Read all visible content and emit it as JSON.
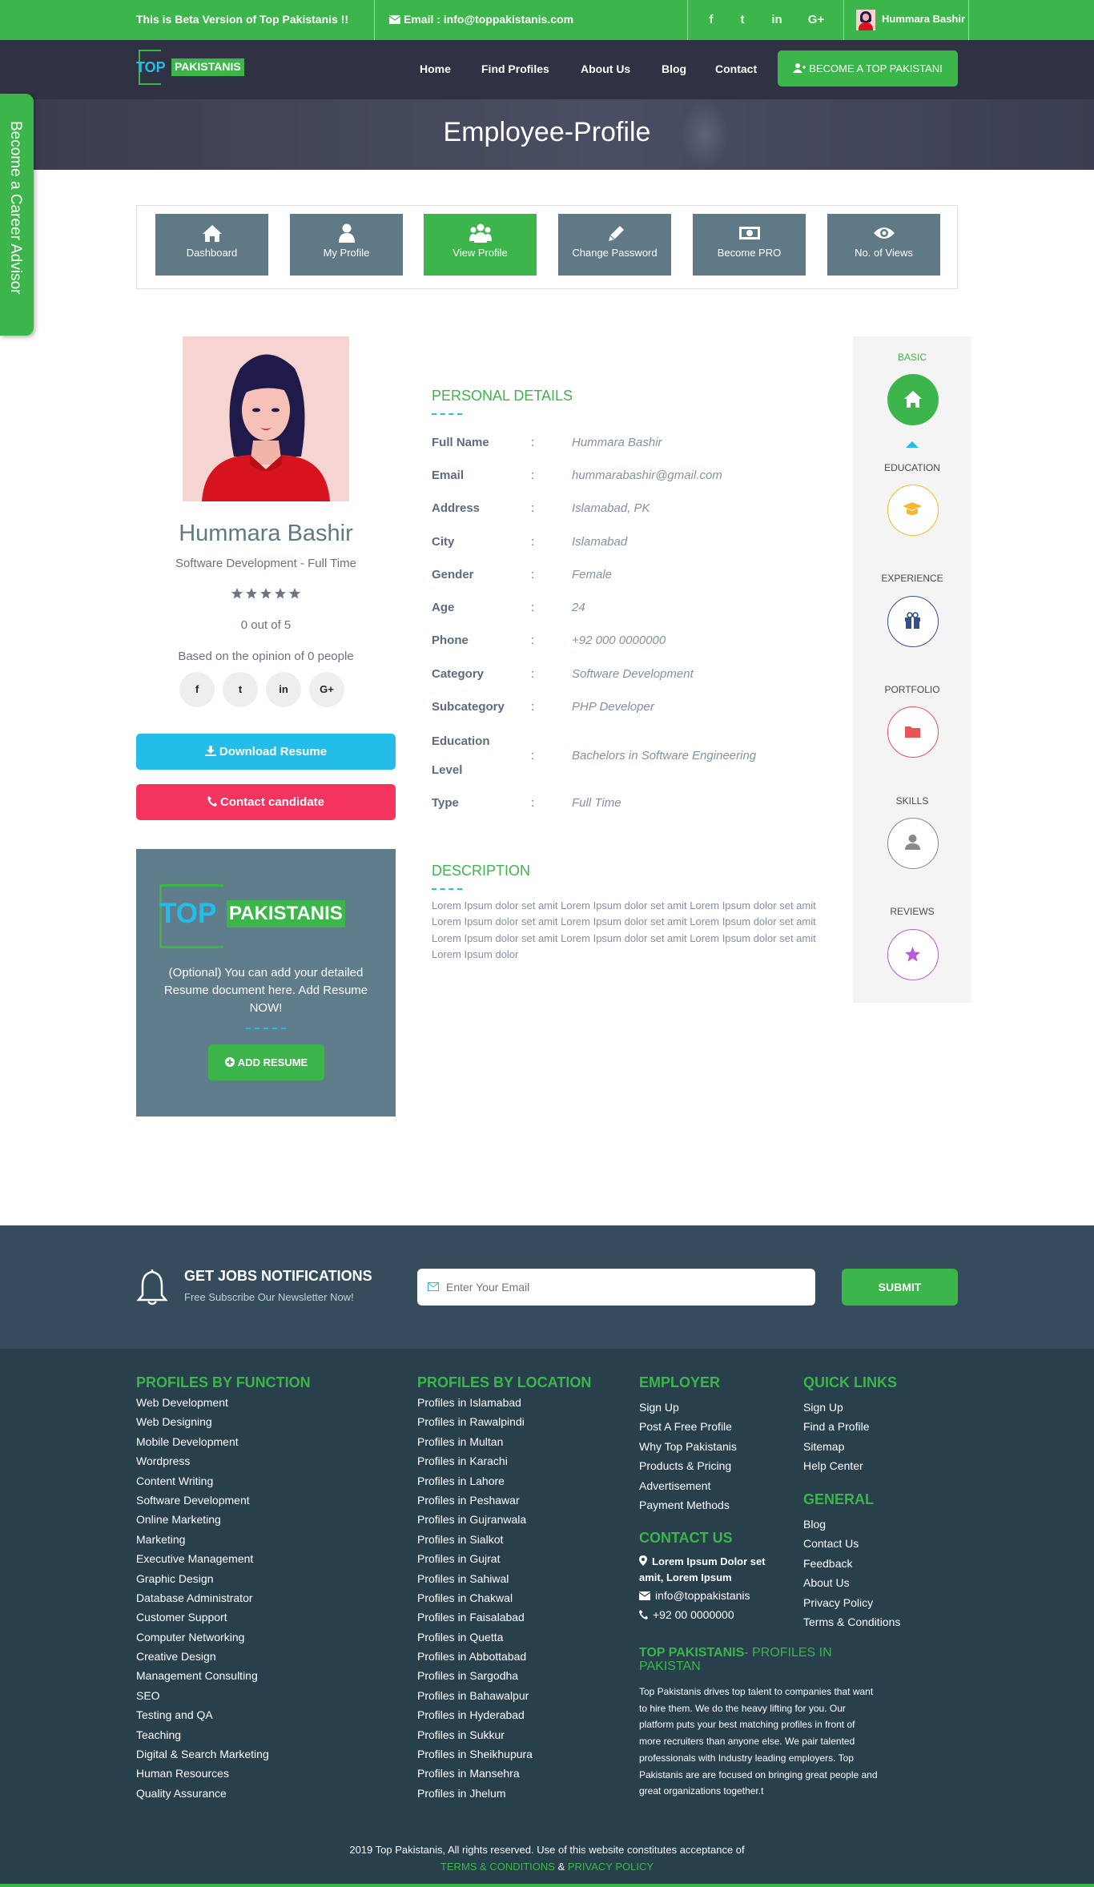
{
  "topbar": {
    "beta_text": "This is Beta Version of Top Pakistanis !!",
    "email_text": "Email : info@toppakistanis.com",
    "social": [
      "f",
      "t",
      "in",
      "G+"
    ],
    "user_name": "Hummara Bashir"
  },
  "logo": {
    "part1": "TOP",
    "part2": "PAKISTANIS"
  },
  "nav": {
    "items": [
      "Home",
      "Find Profiles",
      "About Us",
      "Blog",
      "Contact"
    ],
    "cta": "BECOME A TOP PAKISTANI"
  },
  "page_title": "Employee-Profile",
  "career_tab": "Become a Career Advisor",
  "tabs": [
    {
      "label": "Dashboard",
      "icon": "home-icon"
    },
    {
      "label": "My Profile",
      "icon": "user-icon"
    },
    {
      "label": "View Profile",
      "icon": "users-icon",
      "active": true
    },
    {
      "label": "Change Password",
      "icon": "pencil-icon"
    },
    {
      "label": "Become PRO",
      "icon": "money-icon"
    },
    {
      "label": "No. of Views",
      "icon": "eye-icon"
    }
  ],
  "profile": {
    "name": "Hummara Bashir",
    "subtitle": "Software Development - Full Time",
    "rating_value": 0,
    "rating_max": 5,
    "rating_text": "0 out of 5",
    "opinion_text": "Based on the opinion of 0 people",
    "social": [
      "f",
      "t",
      "in",
      "G+"
    ],
    "download_label": "Download Resume",
    "contact_label": "Contact candidate"
  },
  "resume_card": {
    "text": "(Optional) You can add your detailed Resume document here. Add Resume NOW!",
    "button": "ADD RESUME"
  },
  "personal_details": {
    "title": "PERSONAL DETAILS",
    "separator": ":",
    "rows": [
      {
        "label": "Full Name",
        "value": "Hummara Bashir"
      },
      {
        "label": "Email",
        "value": "hummarabashir@gmail.com"
      },
      {
        "label": "Address",
        "value": "Islamabad, PK"
      },
      {
        "label": "City",
        "value": "Islamabad"
      },
      {
        "label": "Gender",
        "value": "Female"
      },
      {
        "label": "Age",
        "value": "24"
      },
      {
        "label": "Phone",
        "value": "+92 000 0000000"
      },
      {
        "label": "Category",
        "value": "Software Development"
      },
      {
        "label": "Subcategory",
        "value": "PHP Developer"
      },
      {
        "label": "Education",
        "label2": "Level",
        "value": "Bachelors in Software Engineering"
      },
      {
        "label": "Type",
        "value": "Full Time"
      }
    ]
  },
  "description": {
    "title": "DESCRIPTION",
    "text": "Lorem Ipsum dolor set amit Lorem Ipsum dolor set amit Lorem Ipsum dolor set amit Lorem Ipsum dolor set amit Lorem Ipsum dolor set amit Lorem Ipsum dolor set amit Lorem Ipsum dolor set amit Lorem Ipsum dolor set amit Lorem Ipsum dolor set amit Lorem Ipsum dolor"
  },
  "sidebar": [
    {
      "label": "BASIC",
      "icon": "home-icon",
      "color": "#3cb54a",
      "active": true
    },
    {
      "label": "EDUCATION",
      "icon": "graduation-cap-icon",
      "color": "#f5b82e"
    },
    {
      "label": "EXPERIENCE",
      "icon": "gift-icon",
      "color": "#34508c"
    },
    {
      "label": "PORTFOLIO",
      "icon": "folder-icon",
      "color": "#e8545a"
    },
    {
      "label": "SKILLS",
      "icon": "user-icon",
      "color": "#8a8a8a"
    },
    {
      "label": "REVIEWS",
      "icon": "star-icon",
      "color": "#b85cd6"
    }
  ],
  "newsletter": {
    "title": "GET JOBS NOTIFICATIONS",
    "subtitle": "Free Subscribe Our Newsletter Now!",
    "placeholder": "Enter Your Email",
    "button": "SUBMIT"
  },
  "footer": {
    "function_title": "PROFILES BY FUNCTION",
    "function_items": [
      "Web Development",
      "Web Designing",
      "Mobile Development",
      "Wordpress",
      "Content Writing",
      "Software Development",
      "Online Marketing",
      "Marketing",
      "Executive Management",
      "Graphic Design",
      "Database Administrator",
      "Customer Support",
      "Computer Networking",
      "Creative Design",
      "Management Consulting",
      "SEO",
      "Testing and QA",
      "Teaching",
      "Digital & Search Marketing",
      "Human Resources",
      "Quality Assurance"
    ],
    "location_title": "PROFILES BY LOCATION",
    "location_items": [
      "Profiles in Islamabad",
      "Profiles in Rawalpindi",
      "Profiles in Multan",
      "Profiles in Karachi",
      "Profiles in Lahore",
      "Profiles in Peshawar",
      "Profiles in Gujranwala",
      "Profiles in Sialkot",
      "Profiles in Gujrat",
      "Profiles in Sahiwal",
      "Profiles in Chakwal",
      "Profiles in Faisalabad",
      "Profiles in Quetta",
      "Profiles in Abbottabad",
      "Profiles in Sargodha",
      "Profiles in Bahawalpur",
      "Profiles in Hyderabad",
      "Profiles in Sukkur",
      "Profiles in Sheikhupura",
      "Profiles in Mansehra",
      "Profiles in Jhelum"
    ],
    "employer_title": "EMPLOYER",
    "employer_items": [
      "Sign Up",
      "Post A Free Profile",
      "Why Top Pakistanis",
      "Products & Pricing",
      "Advertisement",
      "Payment Methods"
    ],
    "quick_title": "QUICK LINKS",
    "quick_items": [
      "Sign Up",
      "Find a Profile",
      "Sitemap",
      "Help Center"
    ],
    "general_title": "GENERAL",
    "general_items": [
      "Blog",
      "Contact Us",
      "Feedback",
      "About Us",
      "Privacy Policy",
      "Terms & Conditions"
    ],
    "contact_title": "CONTACT US",
    "contact_address": "Lorem Ipsum Dolor set amit, Lorem Ipsum",
    "contact_email": "info@toppakistanis",
    "contact_phone": "+92 00 0000000",
    "about_title_a": "TOP PAKISTANIS",
    "about_title_b": "- PROFILES IN PAKISTAN",
    "about_text": "Top Pakistanis drives top talent to companies that want to hire them. We do the heavy lifting for you. Our platform puts your best matching profiles in front of more recruiters than anyone else. We pair talented professionals with Industry leading employers. Top Pakistanis are are focused on bringing great people and great organizations together.t",
    "copyright": "2019 Top Pakistanis, All rights reserved. Use of this website constitutes acceptance of",
    "terms_link": "TERMS & CONDITIONS",
    "amp": "&",
    "privacy_link": "PRIVACY POLICY"
  },
  "colors": {
    "green": "#3cb54a",
    "slate": "#607d8b",
    "cyan": "#24bce9",
    "pink": "#f4335f",
    "footer": "#283f4c"
  }
}
